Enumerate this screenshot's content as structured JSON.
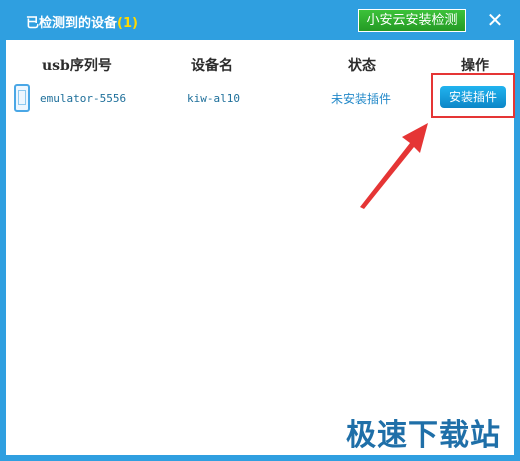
{
  "window": {
    "title_text": "已检测到的设备",
    "device_count": "(1)",
    "check_button": "小安云安装检测",
    "close_symbol": "✕"
  },
  "table": {
    "headers": [
      "usb序列号",
      "设备名",
      "状态",
      "操作"
    ],
    "rows": [
      {
        "serial": "emulator-5556",
        "device_name": "kiw-al10",
        "status": "未安装插件",
        "action_label": "安装插件"
      }
    ]
  },
  "watermark": "极速下载站",
  "colors": {
    "titlebar": "#2f9fe0",
    "check_button": "#33b233",
    "install_button": "#1aa7e8",
    "highlight": "#e53535"
  }
}
